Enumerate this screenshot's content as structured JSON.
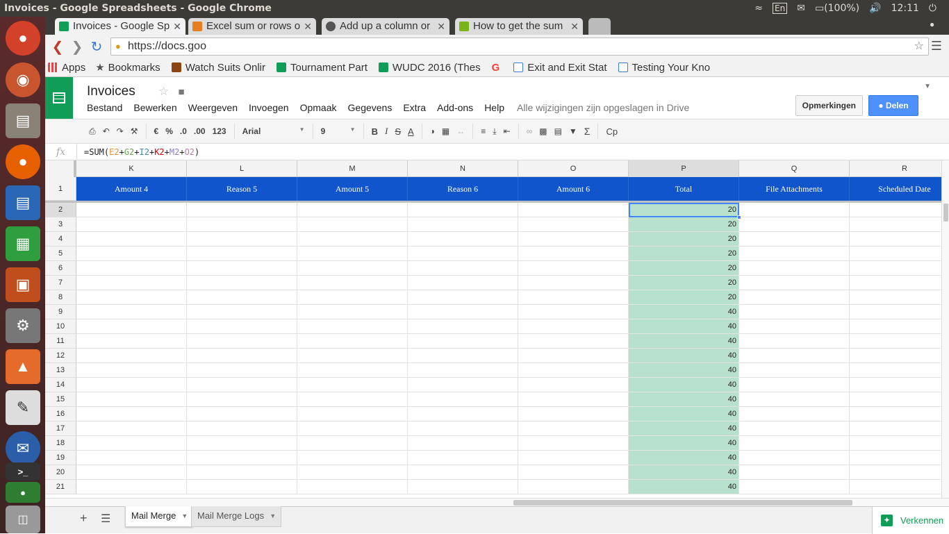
{
  "window": {
    "title": "Invoices - Google Spreadsheets - Google Chrome",
    "tray": {
      "keyboard": "En",
      "battery": "(100%)",
      "time": "12:11"
    }
  },
  "tabs": [
    {
      "label": "Invoices - Google Sp",
      "color": "#0f9d58"
    },
    {
      "label": "Excel sum or rows o",
      "color": "#e67e22"
    },
    {
      "label": "Add up a column or",
      "color": "#555555"
    },
    {
      "label": "How to get the sum",
      "color": "#7ab317"
    }
  ],
  "omnibox": {
    "url": "https://docs.goo"
  },
  "bookmarks": [
    {
      "label": "Apps",
      "icon": "apps-icon"
    },
    {
      "label": "Bookmarks",
      "icon": "star-icon"
    },
    {
      "label": "Watch Suits Onlir",
      "icon": "film-icon"
    },
    {
      "label": "Tournament Part",
      "icon": "sheets-icon"
    },
    {
      "label": "WUDC 2016 (Thes",
      "icon": "sheets-icon"
    },
    {
      "label": "",
      "icon": "google-icon"
    },
    {
      "label": "Exit and Exit Stat",
      "icon": "page-icon"
    },
    {
      "label": "Testing Your Kno",
      "icon": "page-icon"
    }
  ],
  "doc": {
    "title": "Invoices",
    "menu": [
      "Bestand",
      "Bewerken",
      "Weergeven",
      "Invoegen",
      "Opmaak",
      "Gegevens",
      "Extra",
      "Add-ons",
      "Help"
    ],
    "saved_status": "Alle wijzigingen zijn opgeslagen in Drive",
    "comments_label": "Opmerkingen",
    "share_label": "Delen"
  },
  "toolbar": {
    "currency": "€",
    "percent": "%",
    "dec_less": ".0",
    "dec_more": ".00",
    "format": "123",
    "font": "Arial",
    "size": "9",
    "bold": "B",
    "italic": "I",
    "strike": "S",
    "textcolor": "A",
    "cp": "Cp"
  },
  "formula": {
    "fx": "fx",
    "text": "=SUM(E2+G2+I2+K2+M2+O2)"
  },
  "grid": {
    "columns": [
      "K",
      "L",
      "M",
      "N",
      "O",
      "P",
      "Q",
      "R"
    ],
    "selected_column": "P",
    "header_row": [
      "Amount 4",
      "Reason 5",
      "Amount 5",
      "Reason 6",
      "Amount 6",
      "Total",
      "File Attachments",
      "Scheduled Date"
    ],
    "rows": [
      2,
      3,
      4,
      5,
      6,
      7,
      8,
      9,
      10,
      11,
      12,
      13,
      14,
      15,
      16,
      17,
      18,
      19,
      20,
      21
    ],
    "totals": [
      "20",
      "20",
      "20",
      "20",
      "20",
      "20",
      "20",
      "40",
      "40",
      "40",
      "40",
      "40",
      "40",
      "40",
      "40",
      "40",
      "40",
      "40",
      "40",
      "40"
    ],
    "header_color": "#1155cc",
    "selected_fill": "#b7e1cd"
  },
  "sheets": {
    "tabs": [
      "Mail Merge",
      "Mail Merge Logs"
    ],
    "active": "Mail Merge",
    "explore_label": "Verkennen"
  }
}
